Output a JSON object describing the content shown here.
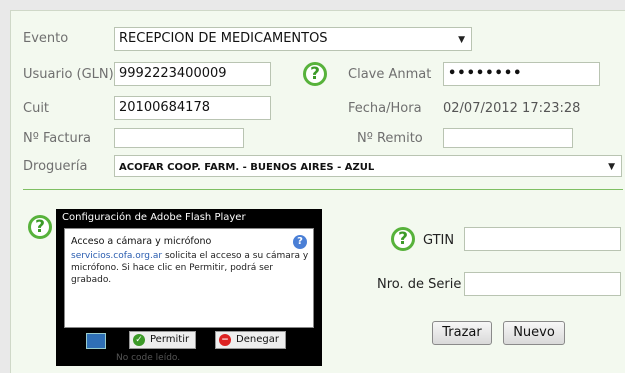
{
  "form": {
    "evento_label": "Evento",
    "evento_value": "RECEPCION DE MEDICAMENTOS",
    "usuario_label": "Usuario (GLN)",
    "usuario_value": "9992223400009",
    "clave_label": "Clave Anmat",
    "clave_value": "••••••••",
    "cuit_label": "Cuit",
    "cuit_value": "20100684178",
    "fecha_label": "Fecha/Hora",
    "fecha_value": "02/07/2012 17:23:28",
    "factura_label": "Nº Factura",
    "factura_value": "",
    "remito_label": "Nº Remito",
    "remito_value": "",
    "drogueria_label": "Droguería",
    "drogueria_value": "ACOFAR COOP. FARM. - BUENOS AIRES - AZUL"
  },
  "help_glyph": "?",
  "scan": {
    "gtin_label": "GTIN",
    "gtin_value": "",
    "serie_label": "Nro. de Serie",
    "serie_value": "",
    "trazar_label": "Trazar",
    "nuevo_label": "Nuevo"
  },
  "flash": {
    "title": "Configuración de Adobe Flash Player",
    "heading": "Acceso a cámara y micrófono",
    "link": "servicios.cofa.org.ar",
    "text": " solicita el acceso a su cámara y micrófono. Si hace clic en Permitir, podrá ser grabado.",
    "allow_label": "Permitir",
    "deny_label": "Denegar",
    "footer": "No code leído."
  },
  "colors": {
    "accent": "#57b23b",
    "panel_bg": "#f3f9ef",
    "divider": "#7fbf63"
  }
}
